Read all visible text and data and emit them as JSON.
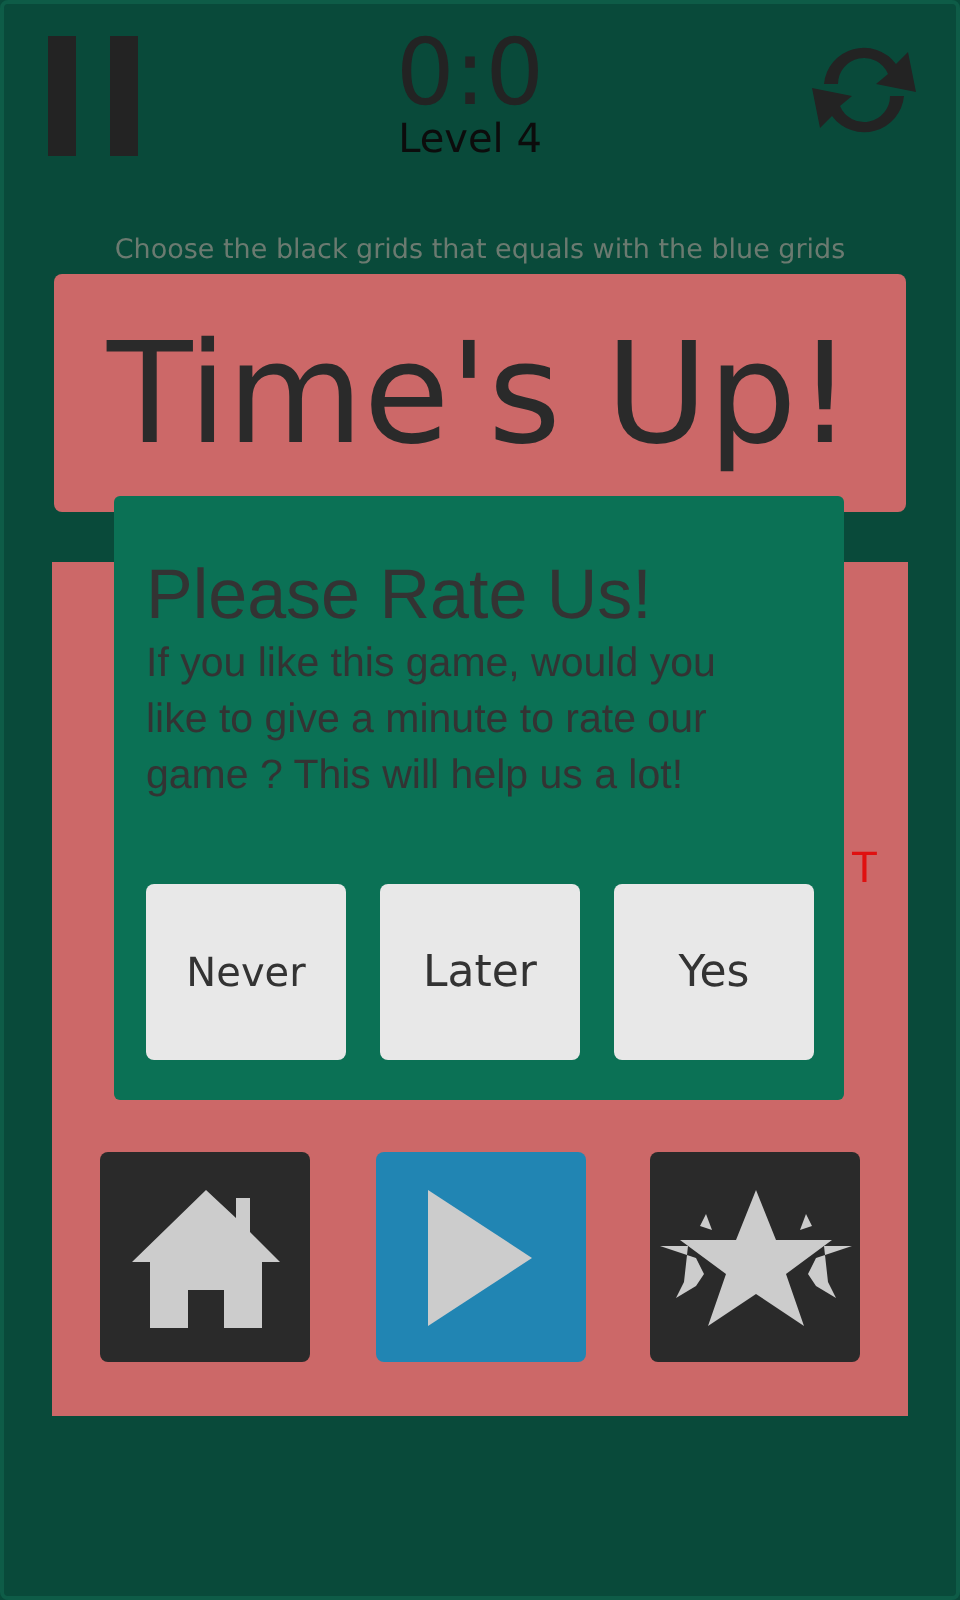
{
  "top_bar": {
    "score": "0:0",
    "level": "Level 4"
  },
  "instruction": "Choose the black grids that equals with the blue grids",
  "banner": "Time's Up!",
  "panel": {
    "partial_text": "T",
    "actions": [
      {
        "kind": "home",
        "selected": false
      },
      {
        "kind": "play",
        "selected": true
      },
      {
        "kind": "rate",
        "selected": false
      }
    ]
  },
  "dialog": {
    "title": "Please Rate Us!",
    "message": "If you like this game, would you like to give a minute to rate our game ? This will help us a lot!",
    "buttons": [
      "Never",
      "Later",
      "Yes"
    ]
  }
}
